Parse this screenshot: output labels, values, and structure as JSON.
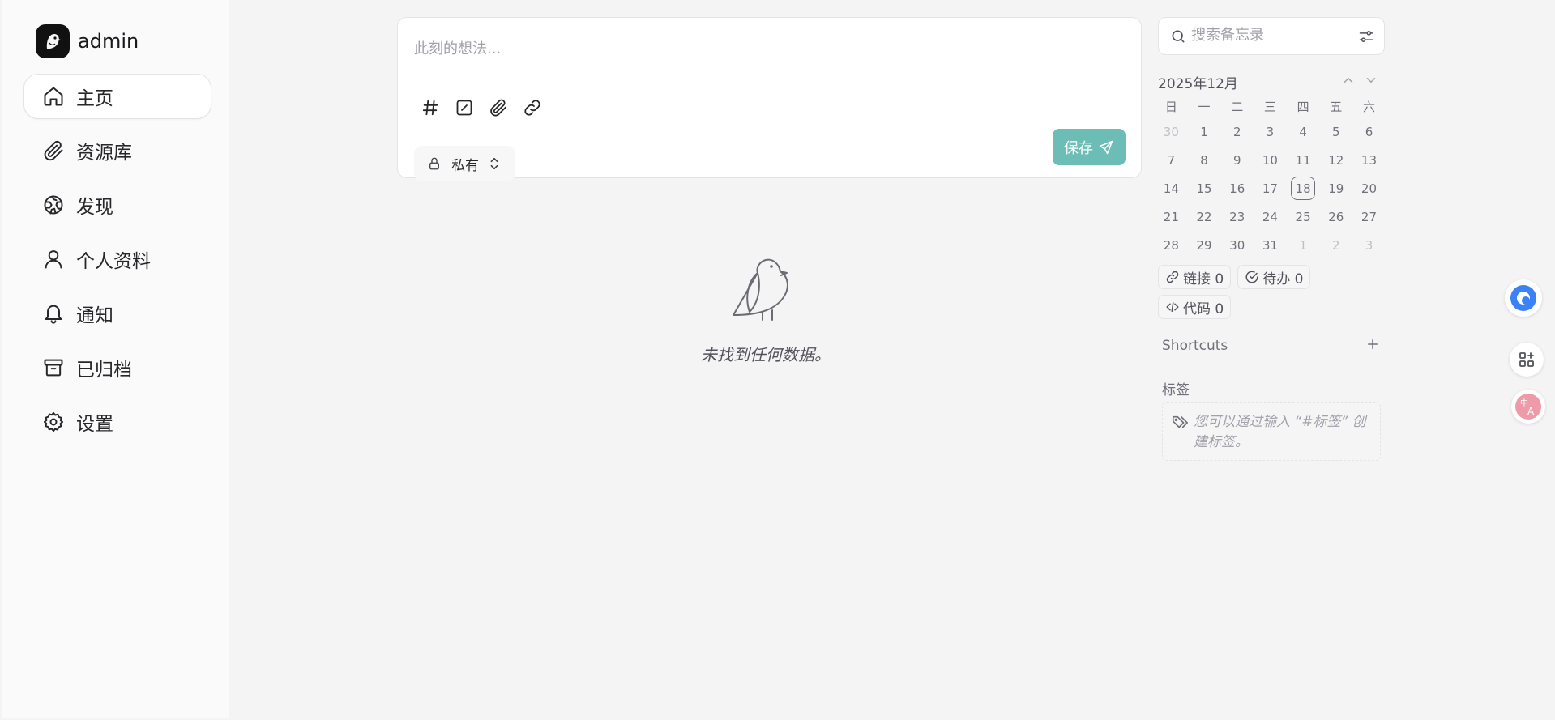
{
  "user": {
    "name": "admin"
  },
  "nav": [
    {
      "label": "主页"
    },
    {
      "label": "资源库"
    },
    {
      "label": "发现"
    },
    {
      "label": "个人资料"
    },
    {
      "label": "通知"
    },
    {
      "label": "已归档"
    },
    {
      "label": "设置"
    }
  ],
  "editor": {
    "placeholder": "此刻的想法...",
    "visibility": "私有",
    "save_label": "保存"
  },
  "empty": {
    "text": "未找到任何数据。"
  },
  "search": {
    "placeholder": "搜索备忘录"
  },
  "calendar": {
    "title": "2025年12月",
    "weekdays": [
      "日",
      "一",
      "二",
      "三",
      "四",
      "五",
      "六"
    ],
    "days": [
      "30",
      "1",
      "2",
      "3",
      "4",
      "5",
      "6",
      "7",
      "8",
      "9",
      "10",
      "11",
      "12",
      "13",
      "14",
      "15",
      "16",
      "17",
      "18",
      "19",
      "20",
      "21",
      "22",
      "23",
      "24",
      "25",
      "26",
      "27",
      "28",
      "29",
      "30",
      "31",
      "1",
      "2",
      "3"
    ],
    "today": "18"
  },
  "stats": {
    "links": "链接 0",
    "todos": "待办 0",
    "code": "代码 0"
  },
  "shortcuts": {
    "title": "Shortcuts"
  },
  "tags": {
    "title": "标签",
    "hint": "您可以通过输入 “#标签” 创建标签。"
  },
  "colors": {
    "accent": "#6cbdb5",
    "background": "#f4f4f5",
    "sidebar": "#fafafa"
  }
}
